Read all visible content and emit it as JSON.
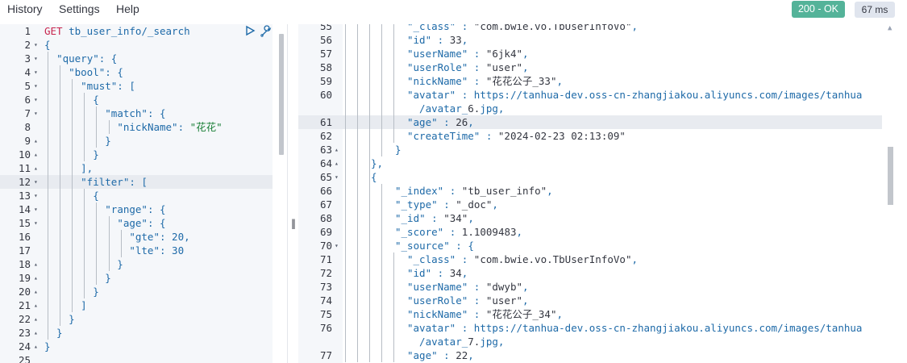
{
  "menu": {
    "history": "History",
    "settings": "Settings",
    "help": "Help"
  },
  "status": {
    "code": "200 - OK",
    "time": "67 ms"
  },
  "request": {
    "lines": [
      "GET tb_user_info/_search",
      "{",
      "  \"query\": {",
      "    \"bool\": {",
      "      \"must\": [",
      "        {",
      "          \"match\": {",
      "            \"nickName\": \"花花\"",
      "          }",
      "        }",
      "      ],",
      "      \"filter\": [",
      "        {",
      "          \"range\": {",
      "            \"age\": {",
      "              \"gte\": 20,",
      "              \"lte\": 30",
      "            }",
      "          }",
      "        }",
      "      ]",
      "    }",
      "  }",
      "}",
      ""
    ],
    "line_numbers": [
      "1",
      "2",
      "3",
      "4",
      "5",
      "6",
      "7",
      "8",
      "9",
      "10",
      "11",
      "12",
      "13",
      "14",
      "15",
      "16",
      "17",
      "18",
      "19",
      "20",
      "21",
      "22",
      "23",
      "24",
      "25"
    ]
  },
  "response": {
    "line_numbers": [
      "55",
      "56",
      "57",
      "58",
      "59",
      "60",
      "",
      "61",
      "62",
      "63",
      "64",
      "65",
      "66",
      "67",
      "68",
      "69",
      "70",
      "71",
      "72",
      "73",
      "74",
      "75",
      "76",
      "",
      "77"
    ],
    "lines": [
      "\"_class\" : \"com.bwie.vo.TbUserInfoVo\",",
      "\"id\" : 33,",
      "\"userName\" : \"6jk4\",",
      "\"userRole\" : \"user\",",
      "\"nickName\" : \"花花公子_33\",",
      "\"avatar\" : \"https://tanhua-dev.oss-cn-zhangjiakou.aliyuncs.com/images/tanhua",
      "  /avatar_6.jpg\",",
      "\"age\" : 26,",
      "\"createTime\" : \"2024-02-23 02:13:09\"",
      "}",
      "},",
      "{",
      "\"_index\" : \"tb_user_info\",",
      "\"_type\" : \"_doc\",",
      "\"_id\" : \"34\",",
      "\"_score\" : 1.1009483,",
      "\"_source\" : {",
      "\"_class\" : \"com.bwie.vo.TbUserInfoVo\",",
      "\"id\" : 34,",
      "\"userName\" : \"dwyb\",",
      "\"userRole\" : \"user\",",
      "\"nickName\" : \"花花公子_34\",",
      "\"avatar\" : \"https://tanhua-dev.oss-cn-zhangjiakou.aliyuncs.com/images/tanhua",
      "  /avatar_7.jpg\",",
      "\"age\" : 22,"
    ]
  }
}
